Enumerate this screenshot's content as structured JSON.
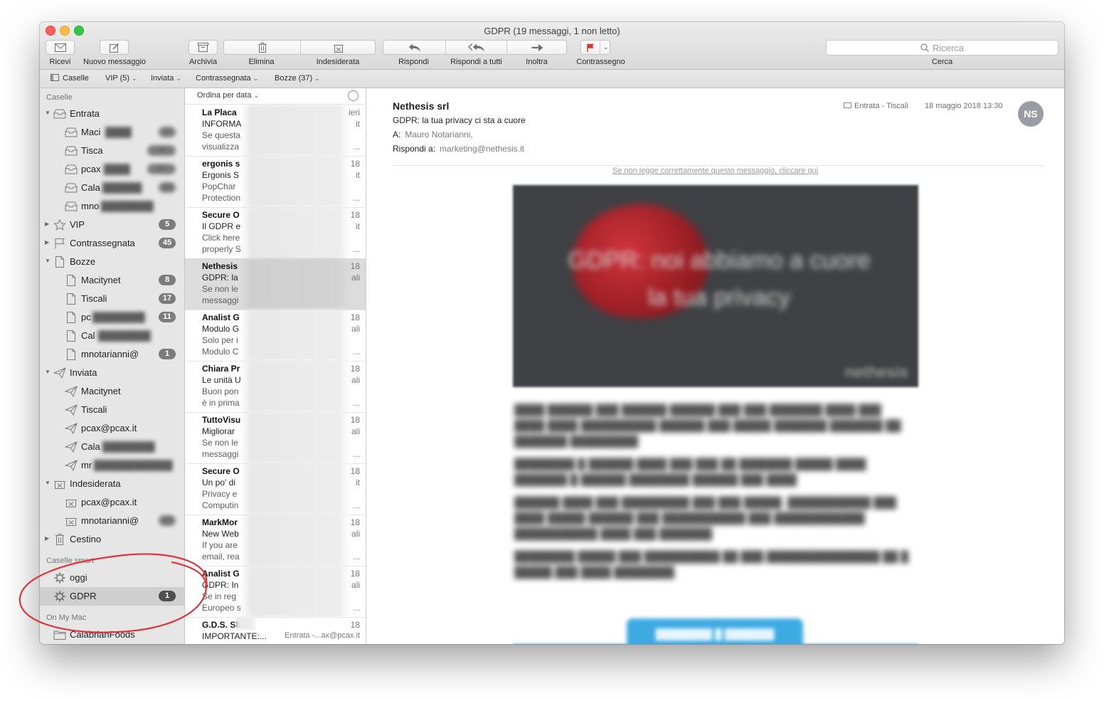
{
  "window": {
    "title": "GDPR (19 messaggi, 1 non letto)",
    "traffic_lights": [
      "#fc605c",
      "#fdbc40",
      "#34c84a"
    ]
  },
  "toolbar": {
    "get_mail": "Ricevi",
    "new_message": "Nuovo messaggio",
    "archive": "Archivia",
    "delete": "Elimina",
    "junk": "Indesiderata",
    "reply": "Rispondi",
    "reply_all": "Rispondi a tutti",
    "forward": "Inoltra",
    "flag": "Contrassegno",
    "flag_color": "#e0302c",
    "search_placeholder": "Ricerca",
    "search_label": "Cerca"
  },
  "favorites": {
    "mailboxes": "Caselle",
    "vip": "VIP (5)",
    "sent": "Inviata",
    "flagged": "Contrassegnata",
    "drafts": "Bozze (37)"
  },
  "sidebar": {
    "section_mailboxes": "Caselle",
    "inbox": {
      "label": "Entrata",
      "accounts": [
        "Maci",
        "Tisca",
        "pcax",
        "Cala",
        "mno"
      ]
    },
    "vip": {
      "label": "VIP",
      "badge": "5"
    },
    "flagged": {
      "label": "Contrassegnata",
      "badge": "45"
    },
    "drafts": {
      "label": "Bozze",
      "accounts": [
        {
          "label": "Macitynet",
          "badge": "8"
        },
        {
          "label": "Tiscali",
          "badge": "17"
        },
        {
          "label": "pc",
          "badge": "11"
        },
        {
          "label": "Cal",
          "badge": ""
        },
        {
          "label": "mnotarianni@",
          "badge": "1"
        }
      ]
    },
    "sent": {
      "label": "Inviata",
      "accounts": [
        "Macitynet",
        "Tiscali",
        "pcax@pcax.it",
        "Cala",
        "mr"
      ]
    },
    "junk": {
      "label": "Indesiderata",
      "accounts": [
        "pcax@pcax.it",
        "mnotarianni@"
      ]
    },
    "trash": {
      "label": "Cestino"
    },
    "section_smart": "Caselle smart",
    "smart": [
      {
        "label": "oggi",
        "badge": ""
      },
      {
        "label": "GDPR",
        "badge": "1"
      }
    ],
    "section_mac": "On My Mac",
    "local": [
      {
        "label": "CalabrianFoods"
      }
    ]
  },
  "message_list": {
    "sort_label": "Ordina per data",
    "messages": [
      {
        "sender": "La Placa",
        "date": "ieri",
        "subject": "INFORMA",
        "tail2": "it",
        "preview1": "Se questa",
        "preview2": "visualizza",
        "tail4": "..."
      },
      {
        "sender": "ergonis s",
        "date": "18",
        "subject": "Ergonis S",
        "tail2": "it",
        "preview1": "PopChar",
        "preview2": "Protection",
        "tail4": "..."
      },
      {
        "sender": "Secure O",
        "date": "18",
        "subject": "Il GDPR e",
        "tail2": "it",
        "preview1": "Click here",
        "preview2": "properly S",
        "tail4": "..."
      },
      {
        "sender": "Nethesis",
        "date": "18",
        "subject": "GDPR: la",
        "tail2": "ali",
        "preview1": "Se non le",
        "preview2": "messaggi",
        "tail4": ""
      },
      {
        "sender": "Analist G",
        "date": "18",
        "subject": "Modulo G",
        "tail2": "ali",
        "preview1": "Solo per i",
        "preview2": "Modulo C",
        "tail4": "..."
      },
      {
        "sender": "Chiara Pr",
        "date": "18",
        "subject": "Le unità U",
        "tail2": "ali",
        "preview1": "Buon pon",
        "preview2": "è in prima",
        "tail4": "..."
      },
      {
        "sender": "TuttoVisu",
        "date": "18",
        "subject": "Migliorar",
        "tail2": "ali",
        "preview1": "Se non le",
        "preview2": "messaggi",
        "tail4": "..."
      },
      {
        "sender": "Secure O",
        "date": "18",
        "subject": "Un po' di",
        "tail2": "it",
        "preview1": "Privacy e",
        "preview2": "Computin",
        "tail4": "..."
      },
      {
        "sender": "MarkMor",
        "date": "18",
        "subject": "New Web",
        "tail2": "ali",
        "preview1": "If you are",
        "preview2": "email, rea",
        "tail4": "..."
      },
      {
        "sender": "Analist G",
        "date": "18",
        "subject": "GDPR: In",
        "tail2": "ali",
        "preview1": "Se in reg",
        "preview2": "Europeo s",
        "tail4": "..."
      },
      {
        "sender": "G.D.S. Sh",
        "date": "18",
        "subject": "IMPORTANTE:...",
        "tail2": "Entrata -...ax@pcax.it",
        "preview1": "",
        "preview2": "",
        "tail4": ""
      }
    ]
  },
  "reading": {
    "from": "Nethesis srl",
    "subject": "GDPR: la tua privacy ci sta a cuore",
    "to_label": "A:",
    "to": "Mauro Notarianni,",
    "reply_to_label": "Rispondi a:",
    "reply_to": "marketing@nethesis.it",
    "mailbox": "Entrata - Tiscali",
    "date": "18 maggio 2018 13:30",
    "avatar_initials": "NS",
    "top_link": "Se non legge correttamente questo messaggio, cliccare qui",
    "hero_text": "GDPR: noi abbiamo a cuore la tua privacy",
    "hero_brand": "nethesis"
  },
  "annotation_color": "#e0323a"
}
